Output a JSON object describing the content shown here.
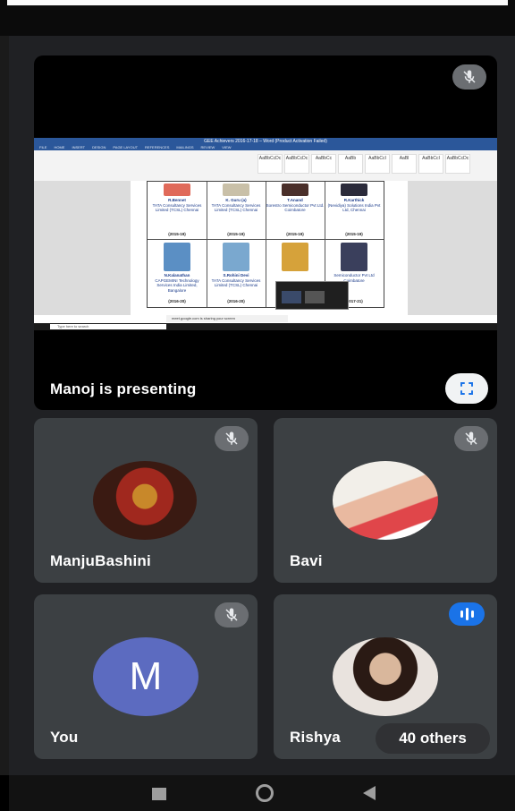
{
  "presentation": {
    "label": "Manoj is presenting",
    "screen": {
      "window_title": "GEE Achievers 2016-17-18 – Word (Product Activation Failed)",
      "menu": [
        "FILE",
        "HOME",
        "INSERT",
        "DESIGN",
        "PAGE LAYOUT",
        "REFERENCES",
        "MAILINGS",
        "REVIEW",
        "VIEW"
      ],
      "styles": [
        "AaBbCcDc",
        "AaBbCcDc",
        "AaBbCc",
        "AaBb",
        "AaBbCcI",
        "AaBl",
        "AaBbCcI",
        "AaBbCcDc"
      ],
      "row1": [
        {
          "name": "R.Bennet",
          "company": "TATA Consultancy Services Limited (TCSL) Chennai",
          "year": "(2015-19)"
        },
        {
          "name": "K. Guru (a)",
          "company": "TATA Consultancy Services Limited (TCSL) Chennai",
          "year": "(2015-19)"
        },
        {
          "name": "T.Anand",
          "company": "Sorestro Semiconductor Pvt Ltd. Coimbatore",
          "year": "(2015-19)"
        },
        {
          "name": "R.Karthick",
          "company": "(Nevidiya) Solutions India Pvt Ltd, Chennai",
          "year": "(2015-19)"
        }
      ],
      "row2": [
        {
          "name": "N.Kalanathan",
          "company": "CAPGEMINI Technology Services India Limited, Bangalore",
          "year": "(2016-20)"
        },
        {
          "name": "S.Rohini Devi",
          "company": "TATA Consultancy Services Limited (TCSL) Chennai",
          "year": "(2016-20)"
        },
        {
          "name": "",
          "company": "",
          "year": ""
        },
        {
          "name": "",
          "company": "Semiconductor Pvt Ltd Coimbatore",
          "year": "(2017-21)"
        }
      ],
      "sharing_notice": "meet.google.com is sharing your screen",
      "taskbar_search": "Type here to search"
    }
  },
  "participants": [
    {
      "name": "ManjuBashini"
    },
    {
      "name": "Bavi"
    },
    {
      "name": "You",
      "initial": "M"
    },
    {
      "name": "Rishya"
    }
  ],
  "others_label": "40 others",
  "colors": {
    "stage": "#202124",
    "tile": "#3c4043",
    "avatar_you": "#5c6bc0",
    "speaking": "#1a73e8"
  },
  "icons": {
    "mute": "mic-off-icon",
    "fullscreen": "fullscreen-icon",
    "speaking": "audio-level-icon",
    "nav": [
      "square-nav-icon",
      "home-circle-icon",
      "back-triangle-icon"
    ]
  }
}
